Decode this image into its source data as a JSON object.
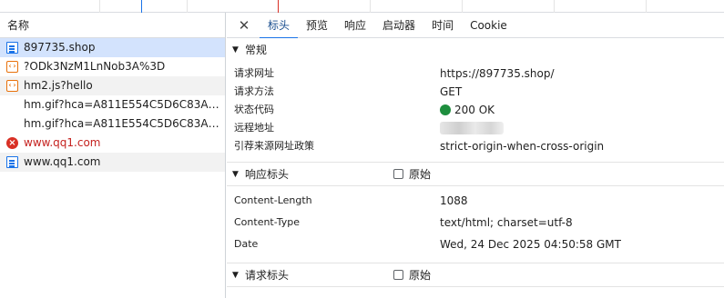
{
  "left_panel": {
    "header": "名称",
    "requests": [
      {
        "name": "897735.shop",
        "icon": "document-icon",
        "state": "selected"
      },
      {
        "name": "?ODk3NzM1LnNob3A%3D",
        "icon": "script-icon",
        "state": "normal"
      },
      {
        "name": "hm2.js?hello",
        "icon": "script-icon",
        "state": "alt"
      },
      {
        "name": "hm.gif?hca=A811E554C5D6C83A&c...",
        "icon": "none",
        "state": "normal"
      },
      {
        "name": "hm.gif?hca=A811E554C5D6C83A&c...",
        "icon": "none",
        "state": "normal"
      },
      {
        "name": "www.qq1.com",
        "icon": "error-icon",
        "state": "error"
      },
      {
        "name": "www.qq1.com",
        "icon": "document-icon",
        "state": "alt"
      }
    ]
  },
  "tabs": {
    "close": "✕",
    "items": [
      "标头",
      "预览",
      "响应",
      "启动器",
      "时间",
      "Cookie"
    ],
    "active": "标头"
  },
  "general": {
    "title": "常规",
    "rows": [
      {
        "key": "请求网址",
        "value": "https://897735.shop/"
      },
      {
        "key": "请求方法",
        "value": "GET"
      },
      {
        "key": "状态代码",
        "value": "200 OK"
      },
      {
        "key": "远程地址",
        "value": ""
      },
      {
        "key": "引荐来源网址政策",
        "value": "strict-origin-when-cross-origin"
      }
    ]
  },
  "response_headers": {
    "title": "响应标头",
    "raw_label": "原始",
    "rows": [
      {
        "key": "Content-Length",
        "value": "1088"
      },
      {
        "key": "Content-Type",
        "value": "text/html; charset=utf-8"
      },
      {
        "key": "Date",
        "value": "Wed, 24 Dec 2025 04:50:58 GMT"
      }
    ]
  },
  "request_headers": {
    "title": "请求标头",
    "raw_label": "原始"
  },
  "colors": {
    "selected_row": "#d3e3fd",
    "status_ok": "#1e8e3e",
    "error_text": "#c5221f",
    "tab_accent": "#1a73e8",
    "timeline_blue": "#1a73e8",
    "timeline_red": "#d93025"
  }
}
